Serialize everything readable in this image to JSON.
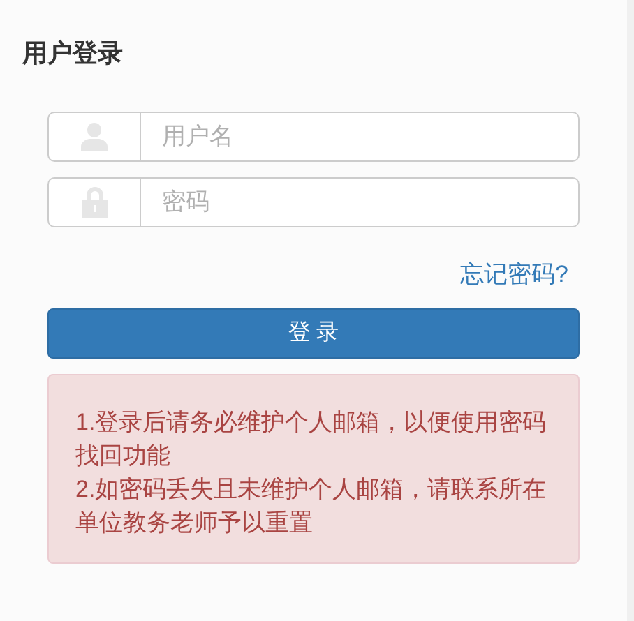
{
  "title": "用户登录",
  "fields": [
    {
      "kind": "user",
      "placeholder": "用户名"
    },
    {
      "kind": "lock",
      "placeholder": "密码"
    }
  ],
  "forgot_link": "忘记密码?",
  "login_button": "登 录",
  "notice": [
    "1.登录后请务必维护个人邮箱，以便使用密码找回功能",
    "2.如密码丢失且未维护个人邮箱，请联系所在单位教务老师予以重置"
  ]
}
